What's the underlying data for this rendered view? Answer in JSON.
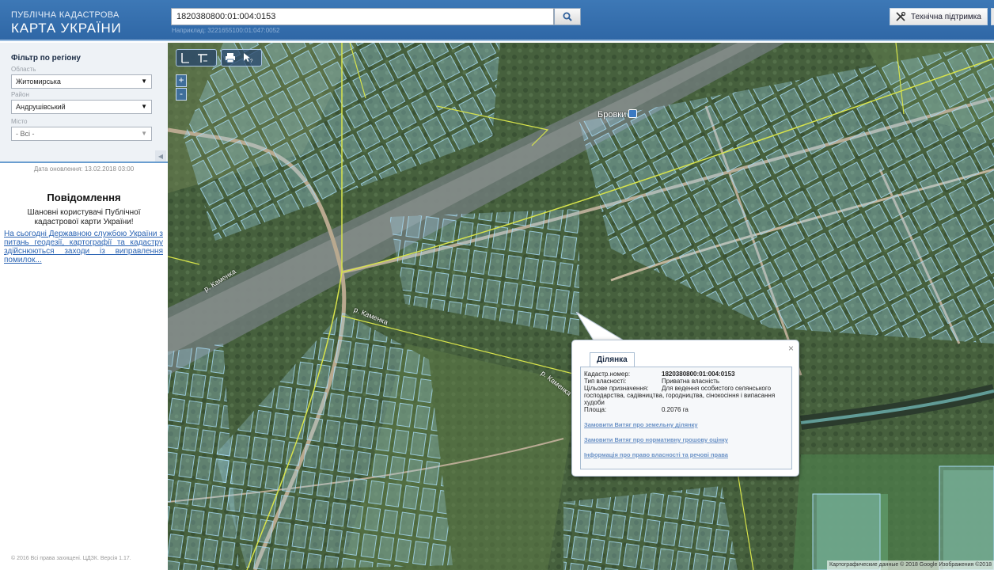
{
  "header": {
    "brand_top": "ПУБЛІЧНА КАДАСТРОВА",
    "brand_main": "КАРТА УКРАЇНИ",
    "search_value": "1820380800:01:004:0153",
    "search_hint": "Наприклад: 3221655100:01:047:0052",
    "search_icon": "search-icon",
    "support_label": "Технічна підтримка",
    "support_icon": "tools-icon"
  },
  "sidebar": {
    "filter_title": "Фільтр по регіону",
    "fields": [
      {
        "label": "Область",
        "value": "Житомирська"
      },
      {
        "label": "Район",
        "value": "Андрушівський"
      },
      {
        "label": "Місто",
        "value": "- Всі -"
      }
    ],
    "update_date": "Дата оновлення: 13.02.2018 03:00",
    "notice_title": "Повідомлення",
    "notice_text": "Шановні користувачі Публічної кадастрової карти України!",
    "notice_link": "На сьогодні Державною службою України з питань геодезії, картографії та кадастру здійснюються заходи із виправлення помилок...",
    "copyright": "© 2016 Всі права захищені. ЦДЗК. Версія 1.17."
  },
  "map": {
    "zoom_in": "+",
    "zoom_out": "-",
    "tools": [
      "ruler-icon",
      "area-ruler-icon",
      "print-icon",
      "info-pointer-icon"
    ],
    "place_label": "Бровки",
    "place_icon": "train-station-icon",
    "river_label_1": "р. Каменка",
    "river_label_2": "р. Каменка",
    "river_label_3": "р. Каменка",
    "attribution": "Картографические данные © 2018 Google Изображения ©2018"
  },
  "popup": {
    "tab": "Ділянка",
    "close": "×",
    "rows": [
      {
        "k": "Кадастр.номер:",
        "v": "1820380800:01:004:0153",
        "bold": true
      },
      {
        "k": "Тип власності:",
        "v": "Приватна власність"
      },
      {
        "k": "Цільове призначення:",
        "v": "Для ведення особистого селянського"
      }
    ],
    "purpose_tail": "господарства, садівництва, городництва, сінокосіння і випасання худоби",
    "area_label": "Площа:",
    "area_value": "0.2076 га",
    "links": [
      "Замовити Витяг про земельну ділянку",
      "Замовити Витяг про нормативну грошову оцінку",
      "Інформація про право власності та речові права"
    ]
  },
  "colors": {
    "header": "#3170ad",
    "parcel_fill": "#9fd6f2",
    "boundary": "#d6e24a",
    "link": "#2a63b3"
  }
}
